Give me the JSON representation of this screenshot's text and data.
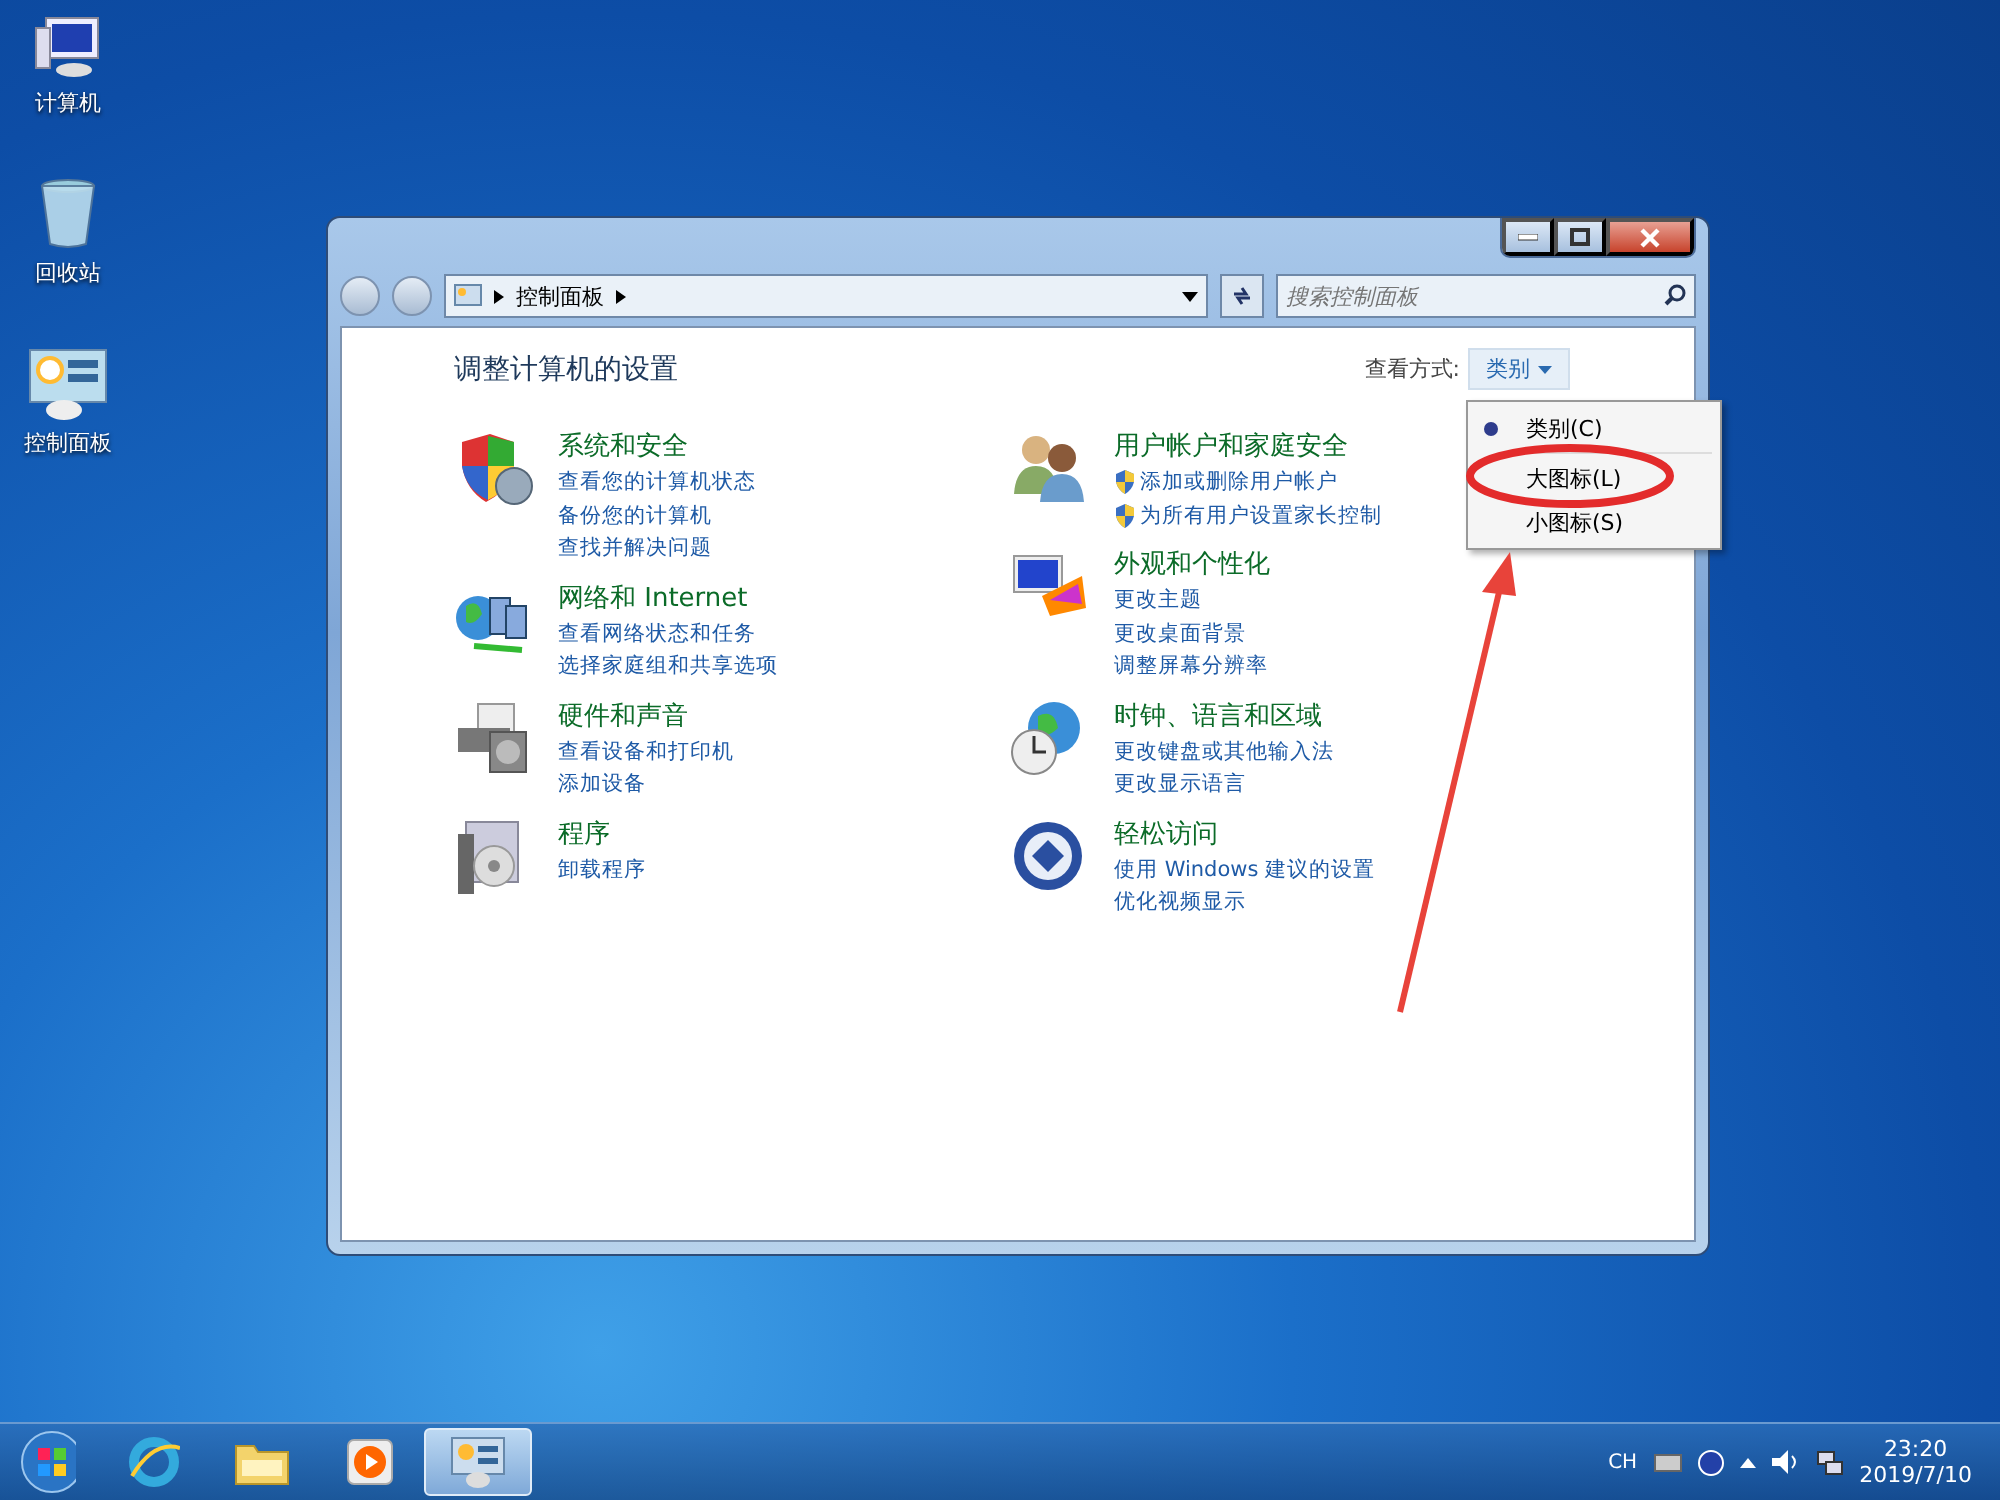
{
  "desktop_icons": [
    {
      "label": "计算机"
    },
    {
      "label": "回收站"
    },
    {
      "label": "控制面板"
    }
  ],
  "window": {
    "address": {
      "path": "控制面板"
    },
    "search": {
      "placeholder": "搜索控制面板"
    },
    "heading": "调整计算机的设置",
    "view_by": {
      "label": "查看方式:",
      "value": "类别"
    },
    "columns": [
      {
        "categories": [
          {
            "title": "系统和安全",
            "links": [
              {
                "text": "查看您的计算机状态",
                "kind": "link"
              },
              {
                "text": "备份您的计算机",
                "kind": "link"
              },
              {
                "text": "查找并解决问题",
                "kind": "link"
              }
            ]
          },
          {
            "title": "网络和 Internet",
            "links": [
              {
                "text": "查看网络状态和任务",
                "kind": "link"
              },
              {
                "text": "选择家庭组和共享选项",
                "kind": "link"
              }
            ]
          },
          {
            "title": "硬件和声音",
            "links": [
              {
                "text": "查看设备和打印机",
                "kind": "link"
              },
              {
                "text": "添加设备",
                "kind": "link"
              }
            ]
          },
          {
            "title": "程序",
            "links": [
              {
                "text": "卸载程序",
                "kind": "link"
              }
            ]
          }
        ]
      },
      {
        "categories": [
          {
            "title": "用户帐户和家庭安全",
            "links": [
              {
                "text": "添加或删除用户帐户",
                "kind": "admin"
              },
              {
                "text": "为所有用户设置家长控制",
                "kind": "admin"
              }
            ]
          },
          {
            "title": "外观和个性化",
            "links": [
              {
                "text": "更改主题",
                "kind": "link"
              },
              {
                "text": "更改桌面背景",
                "kind": "link"
              },
              {
                "text": "调整屏幕分辨率",
                "kind": "link"
              }
            ]
          },
          {
            "title": "时钟、语言和区域",
            "links": [
              {
                "text": "更改键盘或其他输入法",
                "kind": "link"
              },
              {
                "text": "更改显示语言",
                "kind": "link"
              }
            ]
          },
          {
            "title": "轻松访问",
            "links": [
              {
                "text": "使用 Windows 建议的设置",
                "kind": "link"
              },
              {
                "text": "优化视频显示",
                "kind": "link"
              }
            ]
          }
        ]
      }
    ],
    "view_menu": [
      {
        "label": "类别(C)",
        "selected": true
      },
      {
        "label": "大图标(L)",
        "selected": false
      },
      {
        "label": "小图标(S)",
        "selected": false
      }
    ]
  },
  "taskbar": {
    "items": [
      {
        "kind": "ie",
        "selected": false
      },
      {
        "kind": "folder",
        "selected": false
      },
      {
        "kind": "media",
        "selected": false
      },
      {
        "kind": "panel",
        "selected": true
      }
    ],
    "tray": {
      "language": "CH",
      "time": "23:20",
      "date": "2019/7/10"
    }
  }
}
